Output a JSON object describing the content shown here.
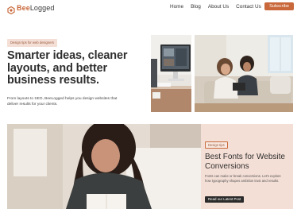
{
  "brand": {
    "logo_prefix": "Bee",
    "logo_suffix": "Logged",
    "accent": "#c9693b"
  },
  "nav": {
    "items": [
      "Home",
      "Blog",
      "About Us",
      "Contact Us"
    ],
    "subscribe_label": "Subscribe"
  },
  "hero": {
    "tag": "Design tips for web designers",
    "title": "Smarter ideas, cleaner layouts, and better business results.",
    "subtitle": "From layouts to SEO, BeeLogged helps you design websites that deliver results for your clients."
  },
  "feature": {
    "tag": "Design tips",
    "title": "Best Fonts for Website Conversions",
    "description": "Fonts can make or break conversions. Let's explore how typography shapes ambition trust and results.",
    "button_label": "Read our Latest Post"
  },
  "colors": {
    "card_bg": "#f4dfd6",
    "accent": "#c9693b",
    "dark": "#2b2b2b"
  }
}
